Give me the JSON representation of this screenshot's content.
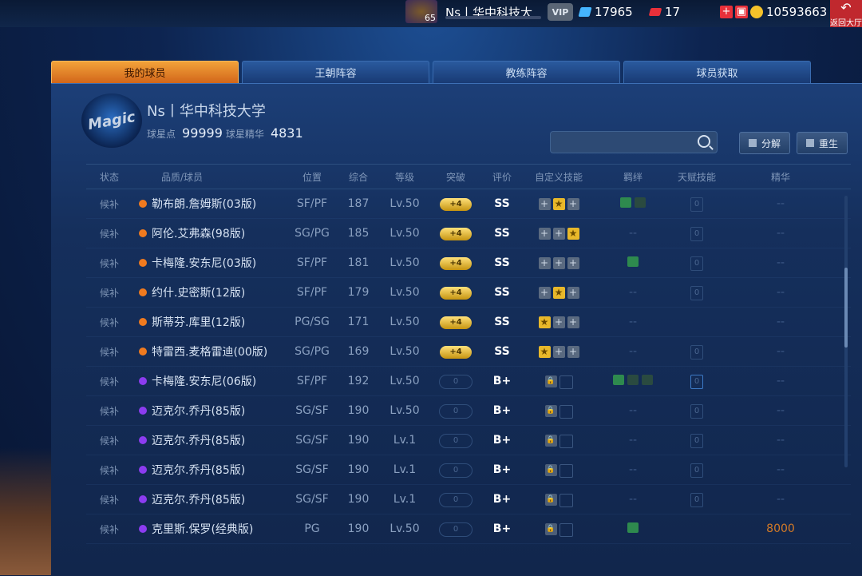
{
  "topbar": {
    "level": "65",
    "username": "Ns丨华中科技大",
    "vip_label": "VIP",
    "diamonds": "17965",
    "tickets": "17",
    "add_label": "+",
    "coins": "10593663",
    "back_label": "返回大厅"
  },
  "tabs": [
    "我的球员",
    "王朝阵容",
    "教练阵容",
    "球员获取"
  ],
  "team": {
    "logo_text": "Magic",
    "name": "Ns丨华中科技大学",
    "star_points_label": "球星点",
    "star_points": "99999",
    "essence_label": "球星精华",
    "essence": "4831"
  },
  "search": {
    "placeholder": ""
  },
  "buttons": {
    "decompose": "分解",
    "rebirth": "重生"
  },
  "columns": [
    "状态",
    "品质/球员",
    "位置",
    "综合",
    "等级",
    "突破",
    "评价",
    "自定义技能",
    "羁绊",
    "天赋技能",
    "精华"
  ],
  "rows": [
    {
      "status": "候补",
      "quality": "orange",
      "name": "勒布朗.詹姆斯(03版)",
      "pos": "SF/PF",
      "ovr": "187",
      "level": "Lv.50",
      "breakthrough": "+4",
      "rating": "SS",
      "skills": [
        "plus",
        "star",
        "plus"
      ],
      "bonds": 2,
      "talent": "0",
      "essence": "--"
    },
    {
      "status": "候补",
      "quality": "orange",
      "name": "阿伦.艾弗森(98版)",
      "pos": "SG/PG",
      "ovr": "185",
      "level": "Lv.50",
      "breakthrough": "+4",
      "rating": "SS",
      "skills": [
        "plus",
        "plus",
        "star"
      ],
      "bonds": 0,
      "talent": "0",
      "essence": "--"
    },
    {
      "status": "候补",
      "quality": "orange",
      "name": "卡梅隆.安东尼(03版)",
      "pos": "SF/PF",
      "ovr": "181",
      "level": "Lv.50",
      "breakthrough": "+4",
      "rating": "SS",
      "skills": [
        "plus",
        "plus",
        "plus"
      ],
      "bonds": 1,
      "talent": "0",
      "essence": "--"
    },
    {
      "status": "候补",
      "quality": "orange",
      "name": "约什.史密斯(12版)",
      "pos": "SF/PF",
      "ovr": "179",
      "level": "Lv.50",
      "breakthrough": "+4",
      "rating": "SS",
      "skills": [
        "plus",
        "star",
        "plus"
      ],
      "bonds": 0,
      "talent": "0",
      "essence": "--"
    },
    {
      "status": "候补",
      "quality": "orange",
      "name": "斯蒂芬.库里(12版)",
      "pos": "PG/SG",
      "ovr": "171",
      "level": "Lv.50",
      "breakthrough": "+4",
      "rating": "SS",
      "skills": [
        "star",
        "plus",
        "plus"
      ],
      "bonds": 0,
      "talent": "",
      "essence": "--"
    },
    {
      "status": "候补",
      "quality": "orange",
      "name": "特雷西.麦格雷迪(00版)",
      "pos": "SG/PG",
      "ovr": "169",
      "level": "Lv.50",
      "breakthrough": "+4",
      "rating": "SS",
      "skills": [
        "star",
        "plus",
        "plus"
      ],
      "bonds": 0,
      "talent": "0",
      "essence": "--"
    },
    {
      "status": "候补",
      "quality": "purple",
      "name": "卡梅隆.安东尼(06版)",
      "pos": "SF/PF",
      "ovr": "192",
      "level": "Lv.50",
      "breakthrough": "0",
      "rating": "B+",
      "skills": [
        "lock",
        "blank"
      ],
      "bonds": 3,
      "talent": "0",
      "essence": "--"
    },
    {
      "status": "候补",
      "quality": "purple",
      "name": "迈克尔.乔丹(85版)",
      "pos": "SG/SF",
      "ovr": "190",
      "level": "Lv.50",
      "breakthrough": "0",
      "rating": "B+",
      "skills": [
        "lock",
        "blank"
      ],
      "bonds": 0,
      "talent": "0",
      "essence": "--"
    },
    {
      "status": "候补",
      "quality": "purple",
      "name": "迈克尔.乔丹(85版)",
      "pos": "SG/SF",
      "ovr": "190",
      "level": "Lv.1",
      "breakthrough": "0",
      "rating": "B+",
      "skills": [
        "lock",
        "blank"
      ],
      "bonds": 0,
      "talent": "0",
      "essence": "--"
    },
    {
      "status": "候补",
      "quality": "purple",
      "name": "迈克尔.乔丹(85版)",
      "pos": "SG/SF",
      "ovr": "190",
      "level": "Lv.1",
      "breakthrough": "0",
      "rating": "B+",
      "skills": [
        "lock",
        "blank"
      ],
      "bonds": 0,
      "talent": "0",
      "essence": "--"
    },
    {
      "status": "候补",
      "quality": "purple",
      "name": "迈克尔.乔丹(85版)",
      "pos": "SG/SF",
      "ovr": "190",
      "level": "Lv.1",
      "breakthrough": "0",
      "rating": "B+",
      "skills": [
        "lock",
        "blank"
      ],
      "bonds": 0,
      "talent": "0",
      "essence": "--"
    },
    {
      "status": "候补",
      "quality": "purple",
      "name": "克里斯.保罗(经典版)",
      "pos": "PG",
      "ovr": "190",
      "level": "Lv.50",
      "breakthrough": "0",
      "rating": "B+",
      "skills": [
        "lock",
        "blank"
      ],
      "bonds": 1,
      "talent": "",
      "essence": "8000"
    }
  ],
  "colors": {
    "accent": "#f2a23a",
    "orange_quality": "#f07a1f",
    "purple_quality": "#8c3cf0",
    "gold": "#e8b82a"
  }
}
